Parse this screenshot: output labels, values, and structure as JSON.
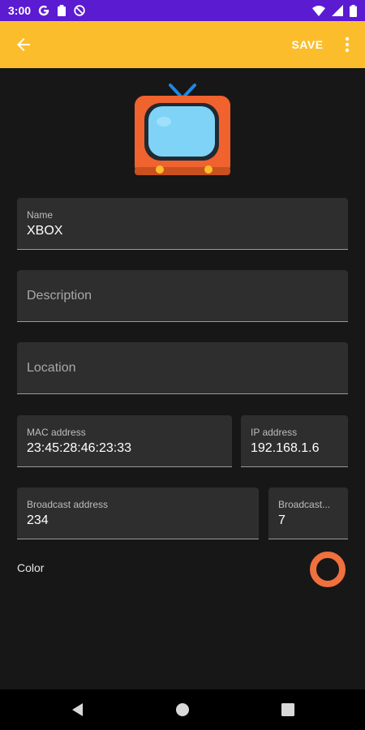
{
  "status_bar": {
    "time": "3:00",
    "icons": [
      "google-g-icon",
      "clipboard-icon",
      "at-sign-icon",
      "wifi-icon",
      "signal-icon",
      "battery-icon"
    ]
  },
  "app_bar": {
    "back_icon": "arrow-back-icon",
    "save_label": "SAVE",
    "more_icon": "more-vert-icon",
    "color": "#fbbd2c"
  },
  "device_icon": "retro-tv-icon",
  "form": {
    "name": {
      "label": "Name",
      "value": "XBOX"
    },
    "description": {
      "placeholder": "Description"
    },
    "location": {
      "placeholder": "Location"
    },
    "mac": {
      "label": "MAC address",
      "value": "23:45:28:46:23:33"
    },
    "ip": {
      "label": "IP address",
      "value": "192.168.1.6"
    },
    "broadcast": {
      "label": "Broadcast address",
      "value": "234"
    },
    "broadcast_port": {
      "label": "Broadcast...",
      "value": "7"
    },
    "color": {
      "label": "Color",
      "swatch": "#f0703e"
    }
  },
  "nav_bar": {
    "back_icon": "nav-back-icon",
    "home_icon": "nav-home-icon",
    "recents_icon": "nav-recents-icon"
  }
}
